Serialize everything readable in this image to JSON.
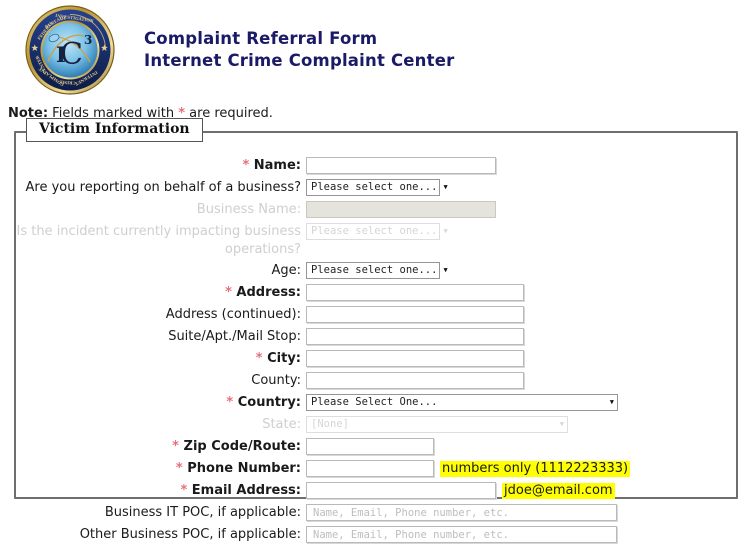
{
  "header": {
    "seal_alt": "ic3-seal",
    "title_line1": "Complaint Referral Form",
    "title_line2": "Internet Crime Complaint Center",
    "title_color": "#1a1a66"
  },
  "note": {
    "lead": "Note:",
    "text_before": " Fields marked with ",
    "star": "*",
    "text_after": " are required.",
    "star_color": "#e8707a"
  },
  "fieldset": {
    "legend": "Victim Information"
  },
  "fields": {
    "name": {
      "label": "Name:",
      "required": true,
      "value": "",
      "type": "text"
    },
    "behalf_of_business": {
      "label": "Are you reporting on behalf of a business?",
      "required": false,
      "value": "Please select one...",
      "type": "select",
      "disabled": false
    },
    "business_name": {
      "label": "Business Name:",
      "required": false,
      "value": "",
      "type": "text",
      "disabled": true
    },
    "impacting_operations": {
      "label_line1": "Is the incident currently impacting business",
      "label_line2": "operations?",
      "required": false,
      "value": "Please select one...",
      "type": "select",
      "disabled": true
    },
    "age": {
      "label": "Age:",
      "required": false,
      "value": "Please select one...",
      "type": "select",
      "disabled": false
    },
    "address": {
      "label": "Address:",
      "required": true,
      "value": "",
      "type": "text"
    },
    "address_continued": {
      "label": "Address (continued):",
      "required": false,
      "value": "",
      "type": "text"
    },
    "suite": {
      "label": "Suite/Apt./Mail Stop:",
      "required": false,
      "value": "",
      "type": "text"
    },
    "city": {
      "label": "City:",
      "required": true,
      "value": "",
      "type": "text"
    },
    "county": {
      "label": "County:",
      "required": false,
      "value": "",
      "type": "text"
    },
    "country": {
      "label": "Country:",
      "required": true,
      "value": "Please Select One...",
      "type": "select",
      "disabled": false
    },
    "state": {
      "label": "State:",
      "required": false,
      "value": "[None]",
      "type": "select",
      "disabled": true
    },
    "zip": {
      "label": "Zip Code/Route:",
      "required": true,
      "value": "",
      "type": "text"
    },
    "phone": {
      "label": "Phone Number:",
      "required": true,
      "value": "",
      "type": "text",
      "hint": "numbers only (1112223333)",
      "hint_color": "#ffff00"
    },
    "email": {
      "label": "Email Address:",
      "required": true,
      "value": "",
      "type": "text",
      "hint": "jdoe@email.com",
      "hint_color": "#ffff00"
    },
    "business_it_poc": {
      "label": "Business IT POC, if applicable:",
      "required": false,
      "value": "",
      "placeholder": "Name, Email, Phone number, etc.",
      "type": "text"
    },
    "other_business_poc": {
      "label": "Other Business POC, if applicable:",
      "required": false,
      "value": "",
      "placeholder": "Name, Email, Phone number, etc.",
      "type": "text"
    }
  },
  "icons": {
    "dropdown_arrow": "▼"
  }
}
